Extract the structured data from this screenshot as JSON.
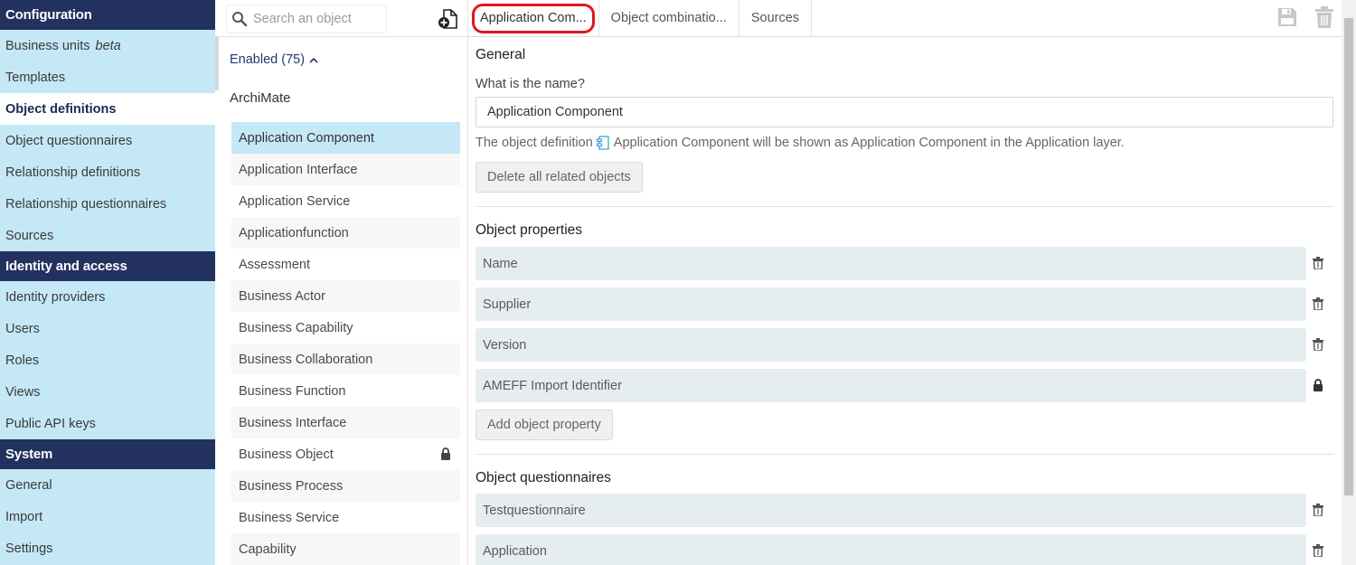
{
  "nav": {
    "sections": [
      {
        "title": "Configuration",
        "items": [
          {
            "label": "Business units",
            "suffix": "beta"
          },
          {
            "label": "Templates"
          },
          {
            "label": "Object definitions",
            "active": true
          },
          {
            "label": "Object questionnaires"
          },
          {
            "label": "Relationship definitions"
          },
          {
            "label": "Relationship questionnaires"
          },
          {
            "label": "Sources"
          }
        ]
      },
      {
        "title": "Identity and access",
        "items": [
          {
            "label": "Identity providers"
          },
          {
            "label": "Users"
          },
          {
            "label": "Roles"
          },
          {
            "label": "Views"
          },
          {
            "label": "Public API keys"
          }
        ]
      },
      {
        "title": "System",
        "items": [
          {
            "label": "General"
          },
          {
            "label": "Import"
          },
          {
            "label": "Settings"
          }
        ]
      }
    ]
  },
  "list": {
    "search_placeholder": "Search an object",
    "enabled_label": "Enabled (75)",
    "group_label": "ArchiMate",
    "objects": [
      {
        "label": "Application Component",
        "selected": true
      },
      {
        "label": "Application Interface"
      },
      {
        "label": "Application Service"
      },
      {
        "label": "Applicationfunction"
      },
      {
        "label": "Assessment"
      },
      {
        "label": "Business Actor"
      },
      {
        "label": "Business Capability"
      },
      {
        "label": "Business Collaboration"
      },
      {
        "label": "Business Function"
      },
      {
        "label": "Business Interface"
      },
      {
        "label": "Business Object",
        "locked": true
      },
      {
        "label": "Business Process"
      },
      {
        "label": "Business Service"
      },
      {
        "label": "Capability"
      }
    ]
  },
  "tabs": [
    {
      "label": "Application Com...",
      "active": true
    },
    {
      "label": "Object combinatio..."
    },
    {
      "label": "Sources"
    }
  ],
  "general": {
    "heading": "General",
    "name_question": "What is the name?",
    "name_value": "Application Component",
    "info_prefix": "The object definition",
    "info_suffix": "Application Component will be shown as Application Component in the Application layer.",
    "delete_button": "Delete all related objects"
  },
  "object_properties": {
    "heading": "Object properties",
    "items": [
      {
        "label": "Name",
        "icon": "trash-icon"
      },
      {
        "label": "Supplier",
        "icon": "trash-icon"
      },
      {
        "label": "Version",
        "icon": "trash-icon"
      },
      {
        "label": "AMEFF Import Identifier",
        "icon": "lock-icon"
      }
    ],
    "add_button": "Add object property"
  },
  "object_questionnaires": {
    "heading": "Object questionnaires",
    "items": [
      {
        "label": "Testquestionnaire",
        "icon": "trash-icon"
      },
      {
        "label": "Application",
        "icon": "trash-icon"
      }
    ]
  },
  "colors": {
    "nav_header": "#22315e",
    "nav_bg": "#c5e8f7",
    "selected_item": "#c5e8f7",
    "tab_highlight": "#e0161e",
    "property_bg": "#e6edf0"
  }
}
